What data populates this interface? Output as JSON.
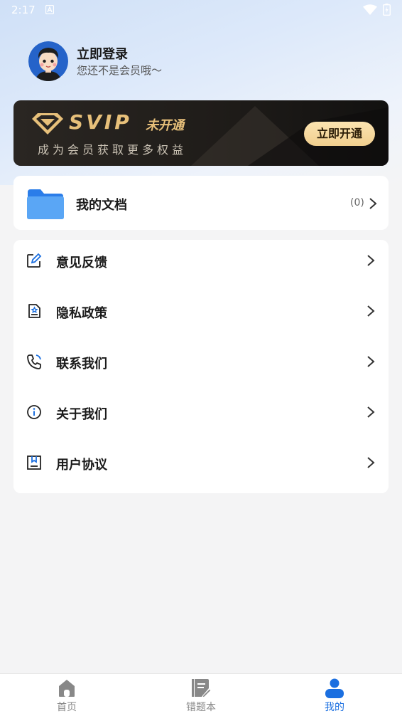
{
  "status_bar": {
    "time": "2:17",
    "icons": [
      "notification-icon",
      "wifi-icon",
      "battery-icon"
    ]
  },
  "profile": {
    "name": "立即登录",
    "subtitle": "您还不是会员哦～"
  },
  "svip_banner": {
    "brand": "SVIP",
    "status": "未开通",
    "benefit": "成为会员获取更多权益",
    "button_label": "立即开通",
    "accent_color": "#e7c07a"
  },
  "documents": {
    "label": "我的文档",
    "count": "(0)",
    "icon": "folder-icon"
  },
  "menu": [
    {
      "label": "意见反馈",
      "icon": "edit-icon"
    },
    {
      "label": "隐私政策",
      "icon": "privacy-icon"
    },
    {
      "label": "联系我们",
      "icon": "phone-icon"
    },
    {
      "label": "关于我们",
      "icon": "info-icon"
    },
    {
      "label": "用户协议",
      "icon": "agreement-icon"
    }
  ],
  "tabbar": {
    "tabs": [
      {
        "label": "首页",
        "icon": "home-icon",
        "active": false
      },
      {
        "label": "错题本",
        "icon": "notebook-icon",
        "active": false
      },
      {
        "label": "我的",
        "icon": "user-icon",
        "active": true
      }
    ],
    "active_color": "#1b6fe0"
  }
}
